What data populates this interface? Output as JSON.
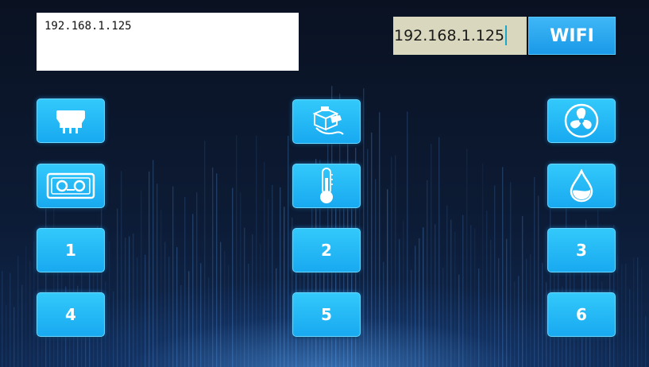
{
  "ip_display": {
    "text": "192.168.1.125"
  },
  "ip_input": {
    "value": "192.168.1.125"
  },
  "wifi_button": {
    "label": "WIFI"
  },
  "left_column": [
    {
      "icon": "power-plug-icon"
    },
    {
      "icon": "cassette-tape-icon"
    },
    {
      "label": "1"
    },
    {
      "label": "4"
    }
  ],
  "middle_column": [
    {
      "icon": "servo-motor-icon"
    },
    {
      "icon": "thermometer-icon"
    },
    {
      "label": "2"
    },
    {
      "label": "5"
    }
  ],
  "right_column": [
    {
      "icon": "fan-icon"
    },
    {
      "icon": "water-drop-icon"
    },
    {
      "label": "3"
    },
    {
      "label": "6"
    }
  ],
  "colors": {
    "background": "#0b1426",
    "tile": "#1fb3f5",
    "wifi": "#2aa8ee",
    "input_bg": "#d9d8be"
  }
}
